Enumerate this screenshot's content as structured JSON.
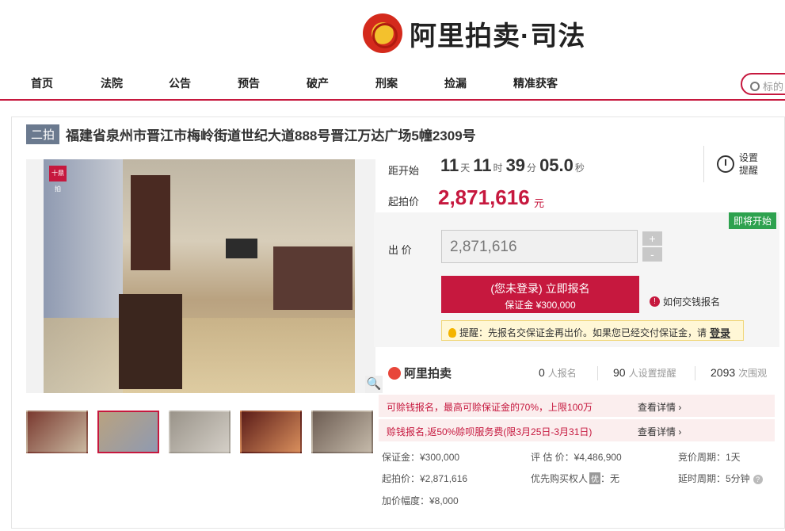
{
  "header": {
    "logo_text": "阿里拍卖·司法",
    "nav": [
      "首页",
      "法院",
      "公告",
      "预告",
      "破产",
      "刑案",
      "捡漏",
      "精准获客"
    ],
    "search_placeholder": "标的"
  },
  "listing": {
    "round_tag": "二拍",
    "title": "福建省泉州市晋江市梅岭街道世纪大道888号晋江万达广场5幢2309号",
    "watermark": "十鼎拍"
  },
  "countdown": {
    "label": "距开始",
    "days": "11",
    "days_unit": "天",
    "hours": "11",
    "hours_unit": "时",
    "minutes": "39",
    "minutes_unit": "分",
    "seconds": "05.0",
    "seconds_unit": "秒"
  },
  "start_price": {
    "label": "起拍价",
    "value": "2,871,616",
    "unit": "元"
  },
  "reminder": {
    "label": "设置提醒"
  },
  "bid": {
    "status_badge": "即将开始",
    "label": "出 价",
    "value": "2,871,616",
    "plus": "+",
    "minus": "-",
    "signup_line1": "(您未登录) 立即报名",
    "signup_line2": "保证金 ¥300,000",
    "howto": "如何交钱报名",
    "tip": "提醒：先报名交保证金再出价。如果您已经交付保证金，请",
    "tip_login": "登录"
  },
  "stats": {
    "brand": "阿里拍卖",
    "signups": "0",
    "signups_label": "人报名",
    "reminders": "90",
    "reminders_label": "人设置提醒",
    "views": "2093",
    "views_label": "次围观"
  },
  "promos": [
    {
      "text": "可赊钱报名，最高可赊保证金的70%，上限100万",
      "more": "查看详情 ›"
    },
    {
      "text": "赊钱报名,返50%赊呗服务费(限3月25日-3月31日)",
      "more": "查看详情 ›"
    }
  ],
  "details": {
    "deposit": "保证金：¥300,000",
    "appraisal": "评 估 价：¥4,486,900",
    "bid_period": "竞价周期：1天",
    "start_price": "起拍价：¥2,871,616",
    "priority": "优先购买权人",
    "priority_tag": "优",
    "priority_value": "：无",
    "delay_period": "延时周期：5分钟",
    "increment": "加价幅度：¥8,000"
  },
  "zoom_icon": "magnifier-icon",
  "colors": {
    "accent": "#c6183e",
    "green_badge": "#2ea24f"
  }
}
